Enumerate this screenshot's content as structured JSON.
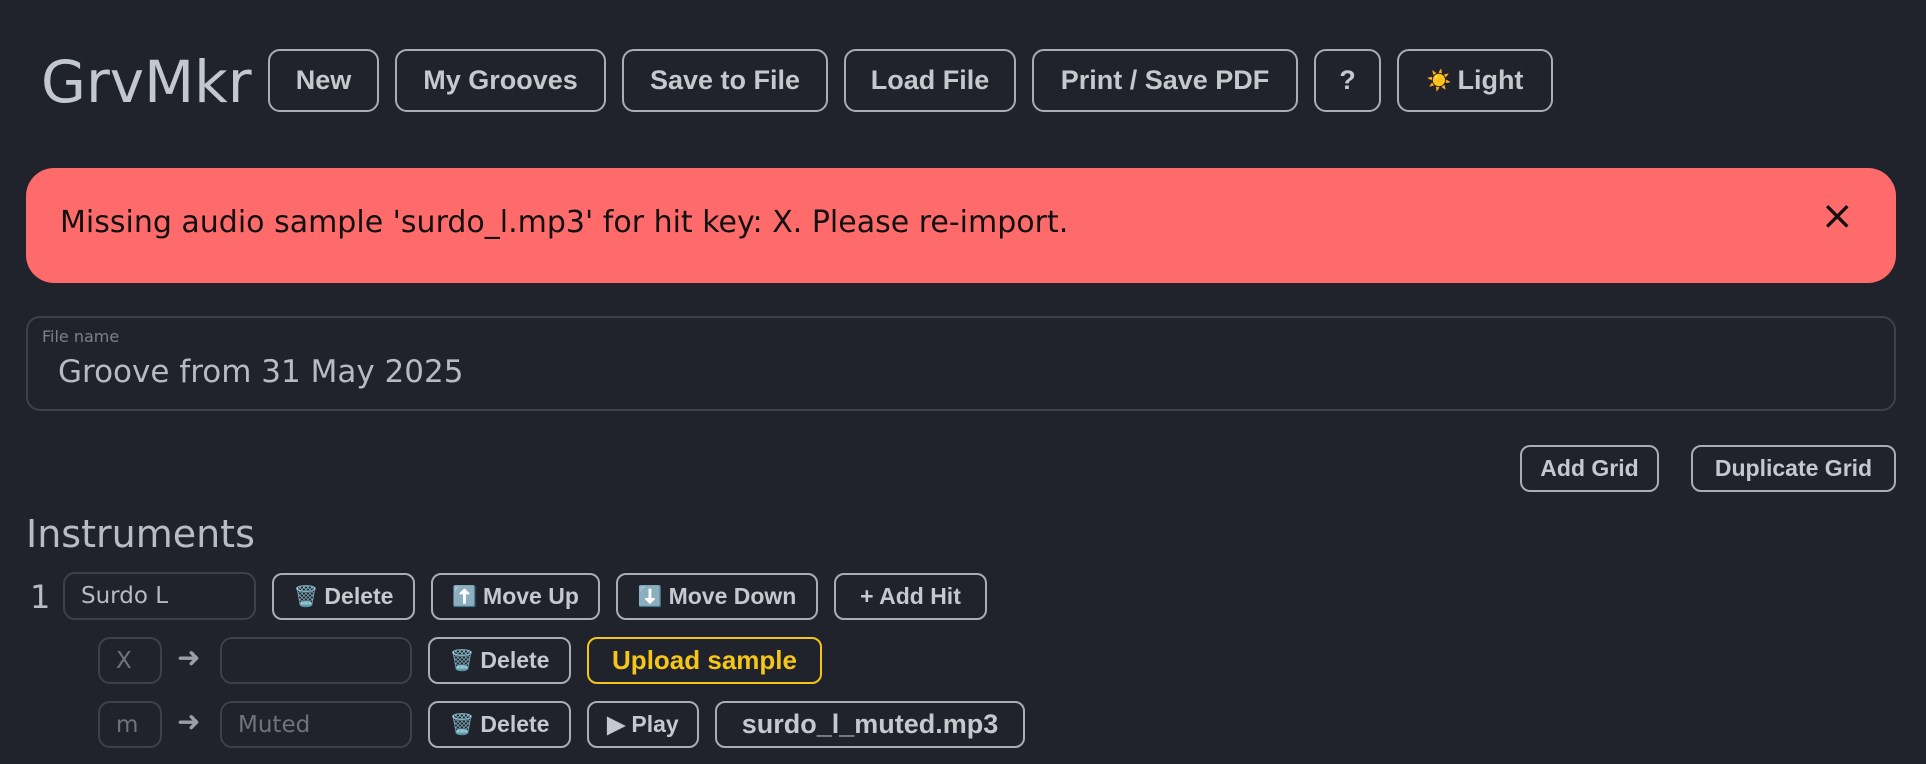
{
  "app": {
    "brand": "GrvMkr"
  },
  "toolbar": {
    "new_label": "New",
    "my_grooves_label": "My Grooves",
    "save_label": "Save to File",
    "load_label": "Load File",
    "print_label": "Print / Save PDF",
    "help_label": "?",
    "theme_label": "Light",
    "theme_icon": "☀️"
  },
  "alert": {
    "message": "Missing audio sample 'surdo_l.mp3' for hit key: X. Please re-import.",
    "close_glyph": "×",
    "color": "#ff6b6b"
  },
  "file": {
    "label": "File name",
    "value": "Groove from 31 May 2025"
  },
  "grid_actions": {
    "add_grid_label": "Add Grid",
    "duplicate_grid_label": "Duplicate Grid"
  },
  "instruments": {
    "title": "Instruments",
    "items": [
      {
        "number": "1",
        "name": "Surdo L",
        "delete_label": "Delete",
        "delete_icon": "🗑️",
        "move_up_label": "Move Up",
        "move_up_icon": "⬆️",
        "move_down_label": "Move Down",
        "move_down_icon": "⬇️",
        "add_hit_label": "+ Add Hit",
        "hits": [
          {
            "key": "X",
            "arrow": "➜",
            "name": "",
            "delete_label": "Delete",
            "action_label": "Upload sample"
          },
          {
            "key": "m",
            "arrow": "➜",
            "name": "Muted",
            "delete_label": "Delete",
            "play_label": "▶ Play",
            "sample": "surdo_l_muted.mp3"
          }
        ]
      }
    ]
  },
  "colors": {
    "background": "#20232b",
    "warning": "#f5c518"
  }
}
